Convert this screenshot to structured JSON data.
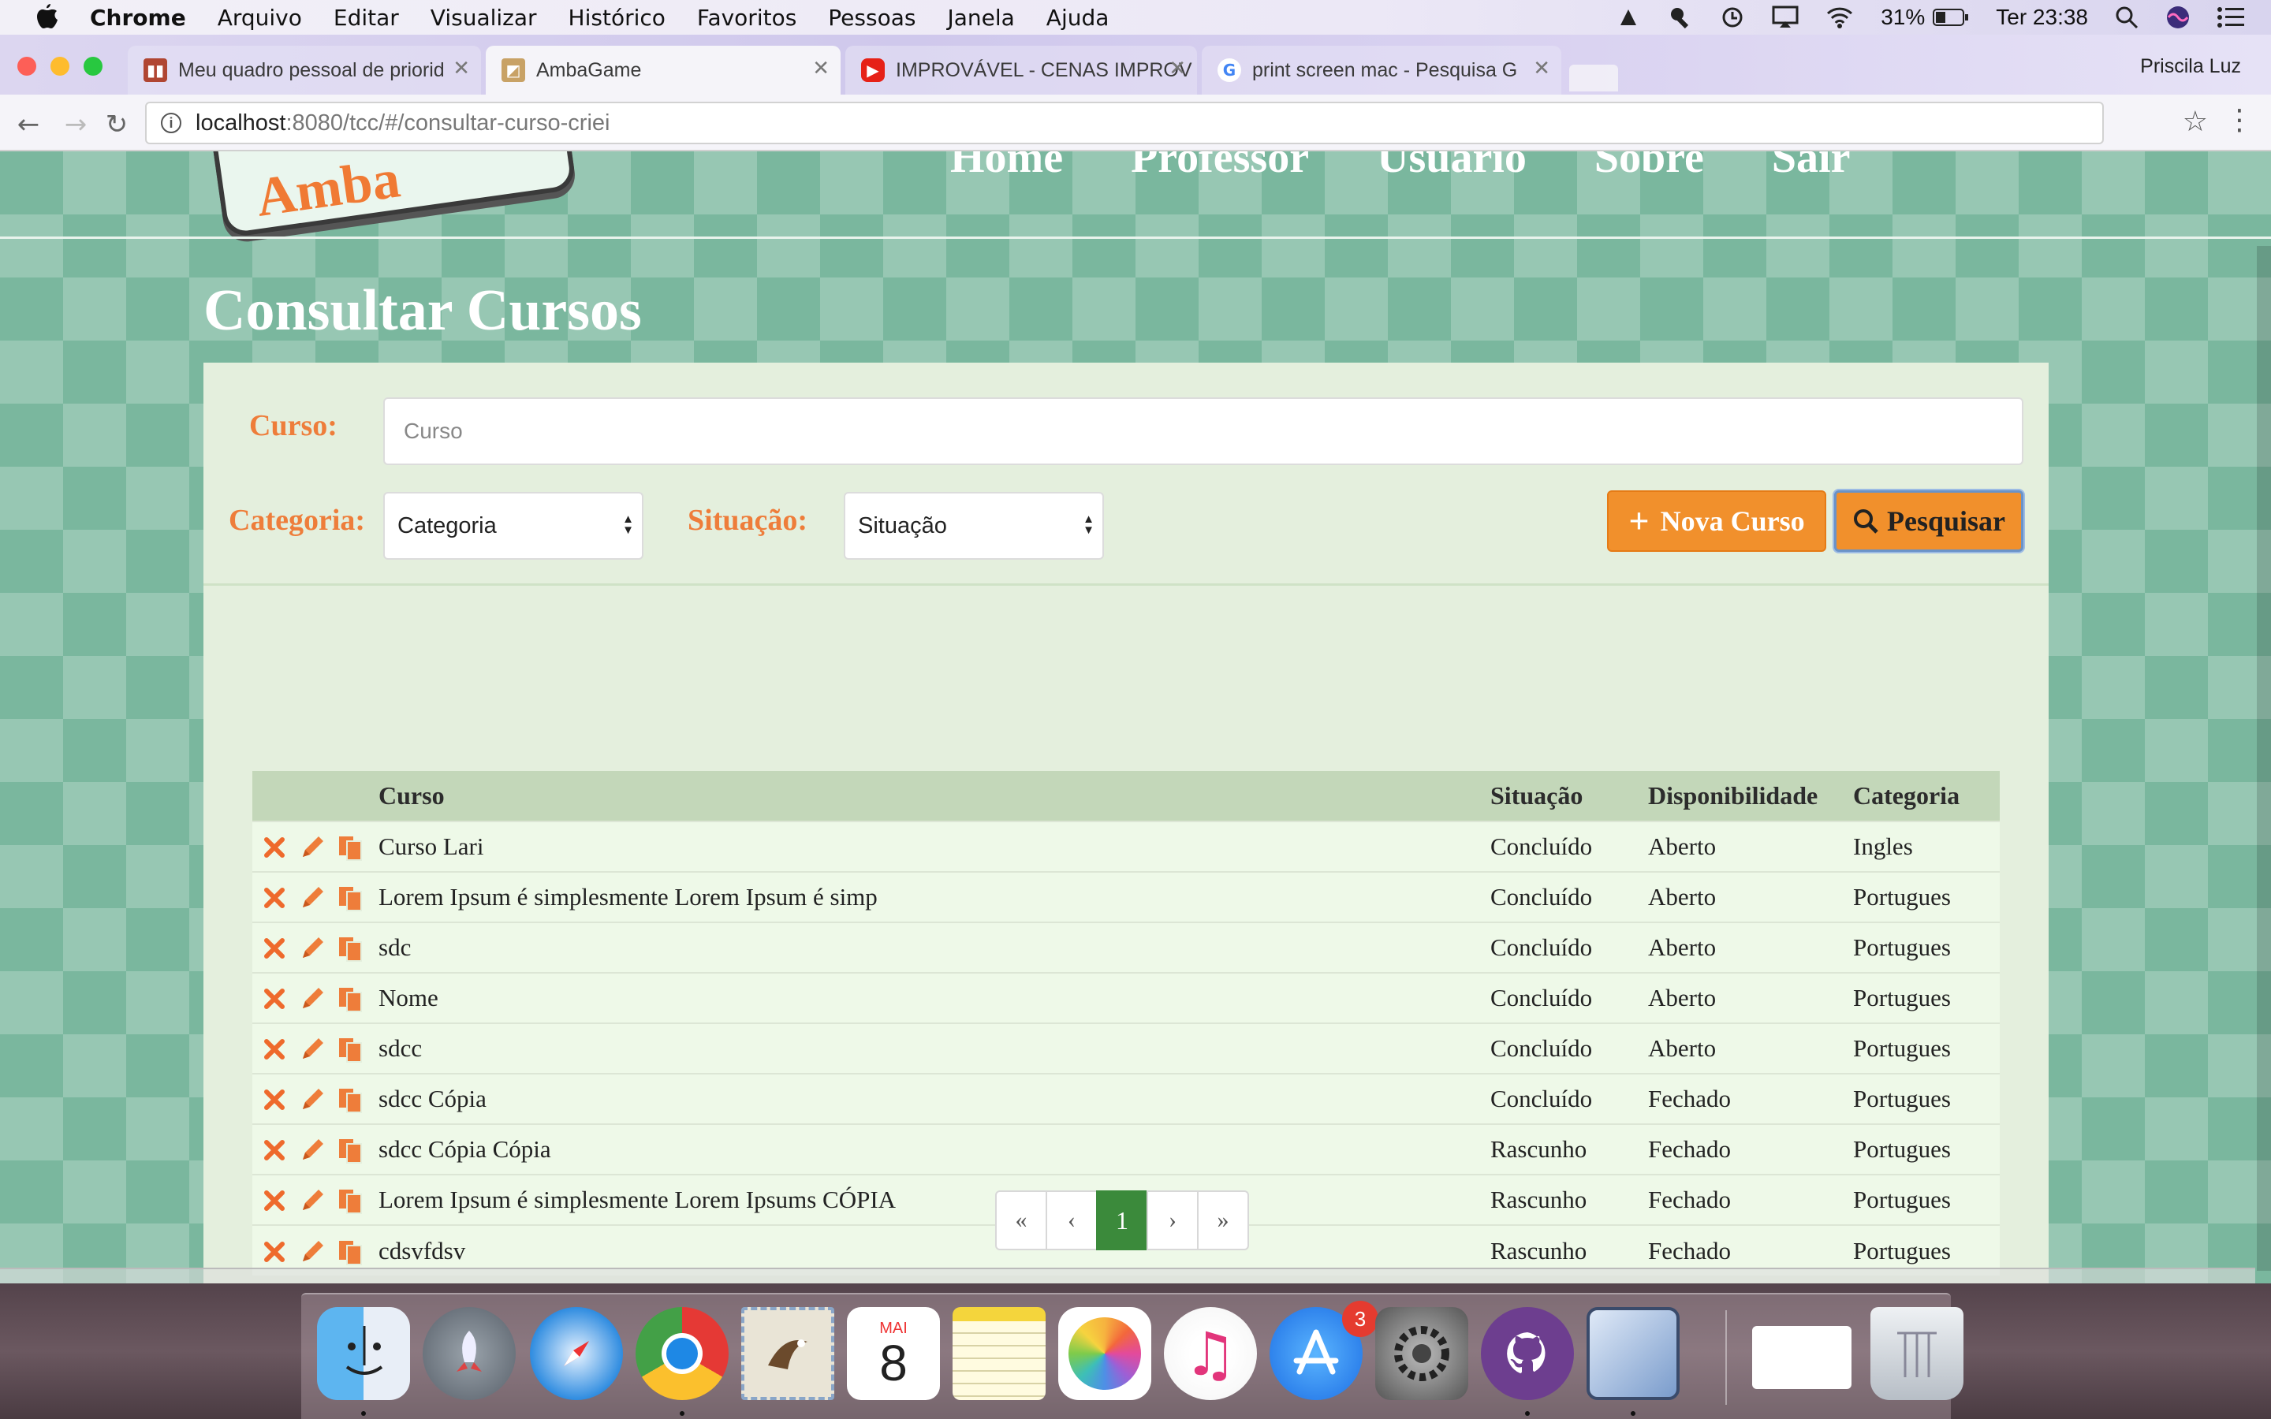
{
  "menubar": {
    "app": "Chrome",
    "items": [
      "Arquivo",
      "Editar",
      "Visualizar",
      "Histórico",
      "Favoritos",
      "Pessoas",
      "Janela",
      "Ajuda"
    ],
    "battery": "31%",
    "clock": "Ter 23:38"
  },
  "browser": {
    "tabs": [
      {
        "title": "Meu quadro pessoal de priorid",
        "icon": "trello-icon",
        "state": "inactive"
      },
      {
        "title": "AmbaGame",
        "icon": "ambagame-icon",
        "state": "active"
      },
      {
        "title": "IMPROVÁVEL - CENAS IMPROV",
        "icon": "youtube-icon",
        "state": "inactive"
      },
      {
        "title": "print screen mac - Pesquisa G",
        "icon": "google-icon",
        "state": "inactive"
      }
    ],
    "profile": "Priscila Luz",
    "url_host": "localhost",
    "url_path": ":8080/tcc/#/consultar-curso-criei"
  },
  "site": {
    "nav": [
      "Home",
      "Professor",
      "Usuário",
      "Sobre",
      "Sair"
    ]
  },
  "page": {
    "title": "Consultar Cursos",
    "filters": {
      "curso_label": "Curso:",
      "curso_placeholder": "Curso",
      "categoria_label": "Categoria:",
      "categoria_value": "Categoria",
      "situacao_label": "Situação:",
      "situacao_value": "Situação"
    },
    "buttons": {
      "nova": "Nova Curso",
      "pesquisar": "Pesquisar"
    },
    "table": {
      "headers": [
        "Curso",
        "Situação",
        "Disponibilidade",
        "Categoria"
      ],
      "rows": [
        [
          "Curso Lari",
          "Concluído",
          "Aberto",
          "Ingles"
        ],
        [
          "Lorem Ipsum é simplesmente Lorem Ipsum é simp",
          "Concluído",
          "Aberto",
          "Portugues"
        ],
        [
          "sdc",
          "Concluído",
          "Aberto",
          "Portugues"
        ],
        [
          "Nome",
          "Concluído",
          "Aberto",
          "Portugues"
        ],
        [
          "sdcc",
          "Concluído",
          "Aberto",
          "Portugues"
        ],
        [
          "sdcc Cópia",
          "Concluído",
          "Fechado",
          "Portugues"
        ],
        [
          "sdcc Cópia Cópia",
          "Rascunho",
          "Fechado",
          "Portugues"
        ],
        [
          "Lorem Ipsum é simplesmente Lorem Ipsums CÓPIA",
          "Rascunho",
          "Fechado",
          "Portugues"
        ],
        [
          "cdsvfdsv",
          "Rascunho",
          "Fechado",
          "Portugues"
        ]
      ]
    },
    "pagination": [
      "«",
      "‹",
      "1",
      "›",
      "»"
    ],
    "current_page": "1"
  },
  "dock": {
    "calendar_month": "MAI",
    "calendar_day": "8",
    "appstore_badge": "3",
    "apps": [
      "finder-icon",
      "launchpad-icon",
      "safari-icon",
      "chrome-icon",
      "mail-icon",
      "calendar-icon",
      "notes-icon",
      "photos-icon",
      "itunes-icon",
      "app-store-icon",
      "system-preferences-icon",
      "github-desktop-icon",
      "virtualbox-icon",
      "window-preview-icon",
      "trash-icon"
    ]
  },
  "colors": {
    "accent_orange": "#f1902c",
    "label_orange": "#ee7d3a",
    "page_green": "#7ab79e",
    "pager_active": "#3b8a3b"
  }
}
